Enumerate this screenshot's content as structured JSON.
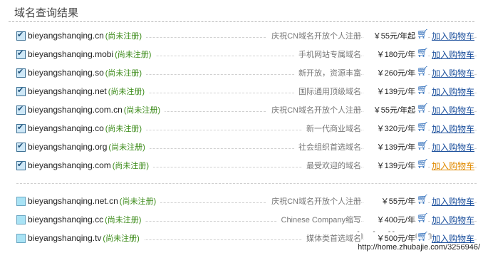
{
  "header": {
    "title": "域名查询结果"
  },
  "cart_icon": "shopping-cart-icon",
  "colors": {
    "status_green": "#3a8a17",
    "link_blue": "#1b4f9c",
    "link_hover": "#e08a00"
  },
  "rows": [
    {
      "domain": "bieyangshanqing.cn",
      "status": "(尚未注册)",
      "desc": "庆祝CN域名开放个人注册",
      "price": "￥55元/年起",
      "cart": "加入购物车",
      "checked": true
    },
    {
      "domain": "bieyangshanqing.mobi",
      "status": "(尚未注册)",
      "desc": "手机网站专属域名",
      "price": "￥180元/年",
      "cart": "加入购物车",
      "checked": true
    },
    {
      "domain": "bieyangshanqing.so",
      "status": "(尚未注册)",
      "desc": "新开放，资源丰富",
      "price": "￥260元/年",
      "cart": "加入购物车",
      "checked": true
    },
    {
      "domain": "bieyangshanqing.net",
      "status": "(尚未注册)",
      "desc": "国际通用顶级域名",
      "price": "￥139元/年",
      "cart": "加入购物车",
      "checked": true
    },
    {
      "domain": "bieyangshanqing.com.cn",
      "status": "(尚未注册)",
      "desc": "庆祝CN域名开放个人注册",
      "price": "￥55元/年起",
      "cart": "加入购物车",
      "checked": true
    },
    {
      "domain": "bieyangshanqing.co",
      "status": "(尚未注册)",
      "desc": "新一代商业域名",
      "price": "￥320元/年",
      "cart": "加入购物车",
      "checked": true
    },
    {
      "domain": "bieyangshanqing.org",
      "status": "(尚未注册)",
      "desc": "社会组织首选域名",
      "price": "￥139元/年",
      "cart": "加入购物车",
      "checked": true
    },
    {
      "domain": "bieyangshanqing.com",
      "status": "(尚未注册)",
      "desc": "最受欢迎的域名",
      "price": "￥139元/年",
      "cart": "加入购物车",
      "checked": true
    },
    {
      "domain": "bieyangshanqing.net.cn",
      "status": "(尚未注册)",
      "desc": "庆祝CN域名开放个人注册",
      "price": "￥55元/年",
      "cart": "加入购物车",
      "checked": false
    },
    {
      "domain": "bieyangshanqing.cc",
      "status": "(尚未注册)",
      "desc": "Chinese Company缩写",
      "price": "￥400元/年",
      "cart": "加入购物车",
      "checked": false
    },
    {
      "domain": "bieyangshanqing.tv",
      "status": "(尚未注册)",
      "desc": "媒体类首选域名",
      "price": "￥500元/年",
      "cart": "加入购物车",
      "checked": false
    }
  ],
  "watermark": {
    "site": "zhubajie.com",
    "url": "http://home.zhubajie.com/3256946/"
  }
}
